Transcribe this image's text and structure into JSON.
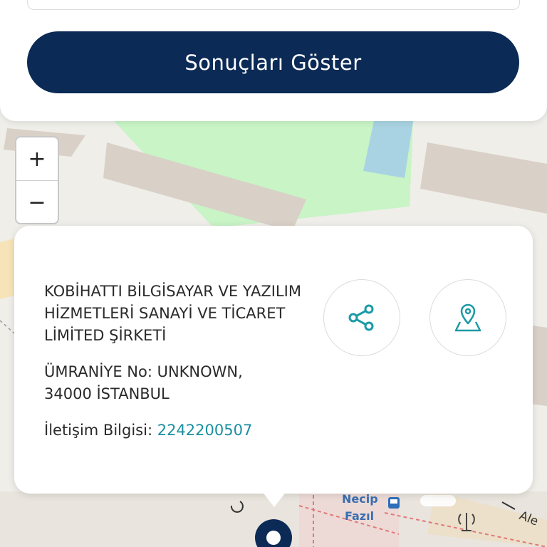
{
  "search_panel": {
    "show_results_label": "Sonuçları Göster"
  },
  "zoom": {
    "zoom_in_label": "+",
    "zoom_out_label": "−"
  },
  "map_labels": {
    "poi_name_line1": "Necip",
    "poi_name_line2": "Fazıl",
    "street_fragment": "Ale"
  },
  "info_card": {
    "company_name": "KOBİHATTI BİLGİSAYAR VE YAZILIM HİZMETLERİ SANAYİ VE TİCARET LİMİTED ŞİRKETİ",
    "address_line1": "ÜMRANİYE No: UNKNOWN,",
    "address_line2": "34000 İSTANBUL",
    "contact_label": "İletişim Bilgisi: ",
    "phone": "2242200507",
    "share_icon": "share-icon",
    "location_icon": "map-pin-icon"
  },
  "colors": {
    "primary_button": "#0b2a55",
    "accent_teal": "#1a8fa0"
  }
}
